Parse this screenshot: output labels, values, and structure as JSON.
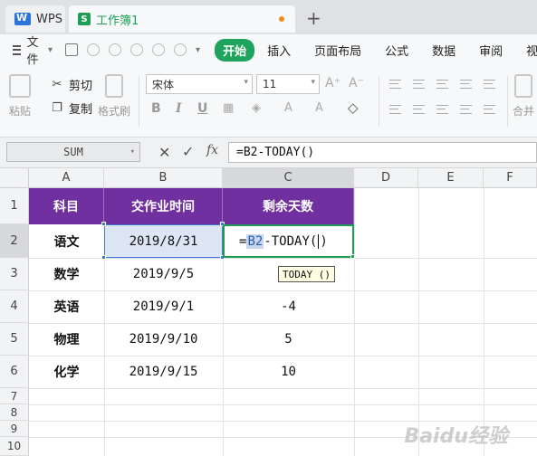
{
  "tabs": {
    "wps_label": "WPS",
    "wps_logo": "W",
    "book_label": "工作簿1",
    "book_logo": "S",
    "new_tab": "+"
  },
  "menu": {
    "file_label": "文件",
    "tabs": [
      "开始",
      "插入",
      "页面布局",
      "公式",
      "数据",
      "审阅",
      "视图"
    ]
  },
  "ribbon": {
    "paste": "粘贴",
    "cut": "剪切",
    "copy": "复制",
    "format_painter": "格式刷",
    "font_name": "宋体",
    "font_size": "11",
    "bold": "B",
    "italic": "I",
    "underline": "U",
    "merge": "合并"
  },
  "formula": {
    "name_box": "SUM",
    "cancel": "✕",
    "confirm": "✓",
    "fx": "fx",
    "input": "=B2-TODAY()"
  },
  "grid": {
    "columns": [
      "A",
      "B",
      "C",
      "D",
      "E",
      "F"
    ],
    "rows": [
      "1",
      "2",
      "3",
      "4",
      "5",
      "6",
      "7",
      "8",
      "9",
      "10"
    ],
    "headers": [
      "科目",
      "交作业时间",
      "剩余天数"
    ],
    "data": [
      {
        "subject": "语文",
        "date": "2019/8/31",
        "remain": ""
      },
      {
        "subject": "数学",
        "date": "2019/9/5",
        "remain": ""
      },
      {
        "subject": "英语",
        "date": "2019/9/1",
        "remain": "-4"
      },
      {
        "subject": "物理",
        "date": "2019/9/10",
        "remain": "5"
      },
      {
        "subject": "化学",
        "date": "2019/9/15",
        "remain": "10"
      }
    ],
    "edit": {
      "prefix": "=",
      "ref": "B2",
      "suffix": "-TODAY(",
      "close": ")"
    },
    "tooltip": "TODAY ()"
  },
  "watermark": "Baidu经验",
  "colors": {
    "header_bg": "#7030a0",
    "accent_green": "#1ea45d",
    "selection_blue": "#3d7ad6"
  }
}
